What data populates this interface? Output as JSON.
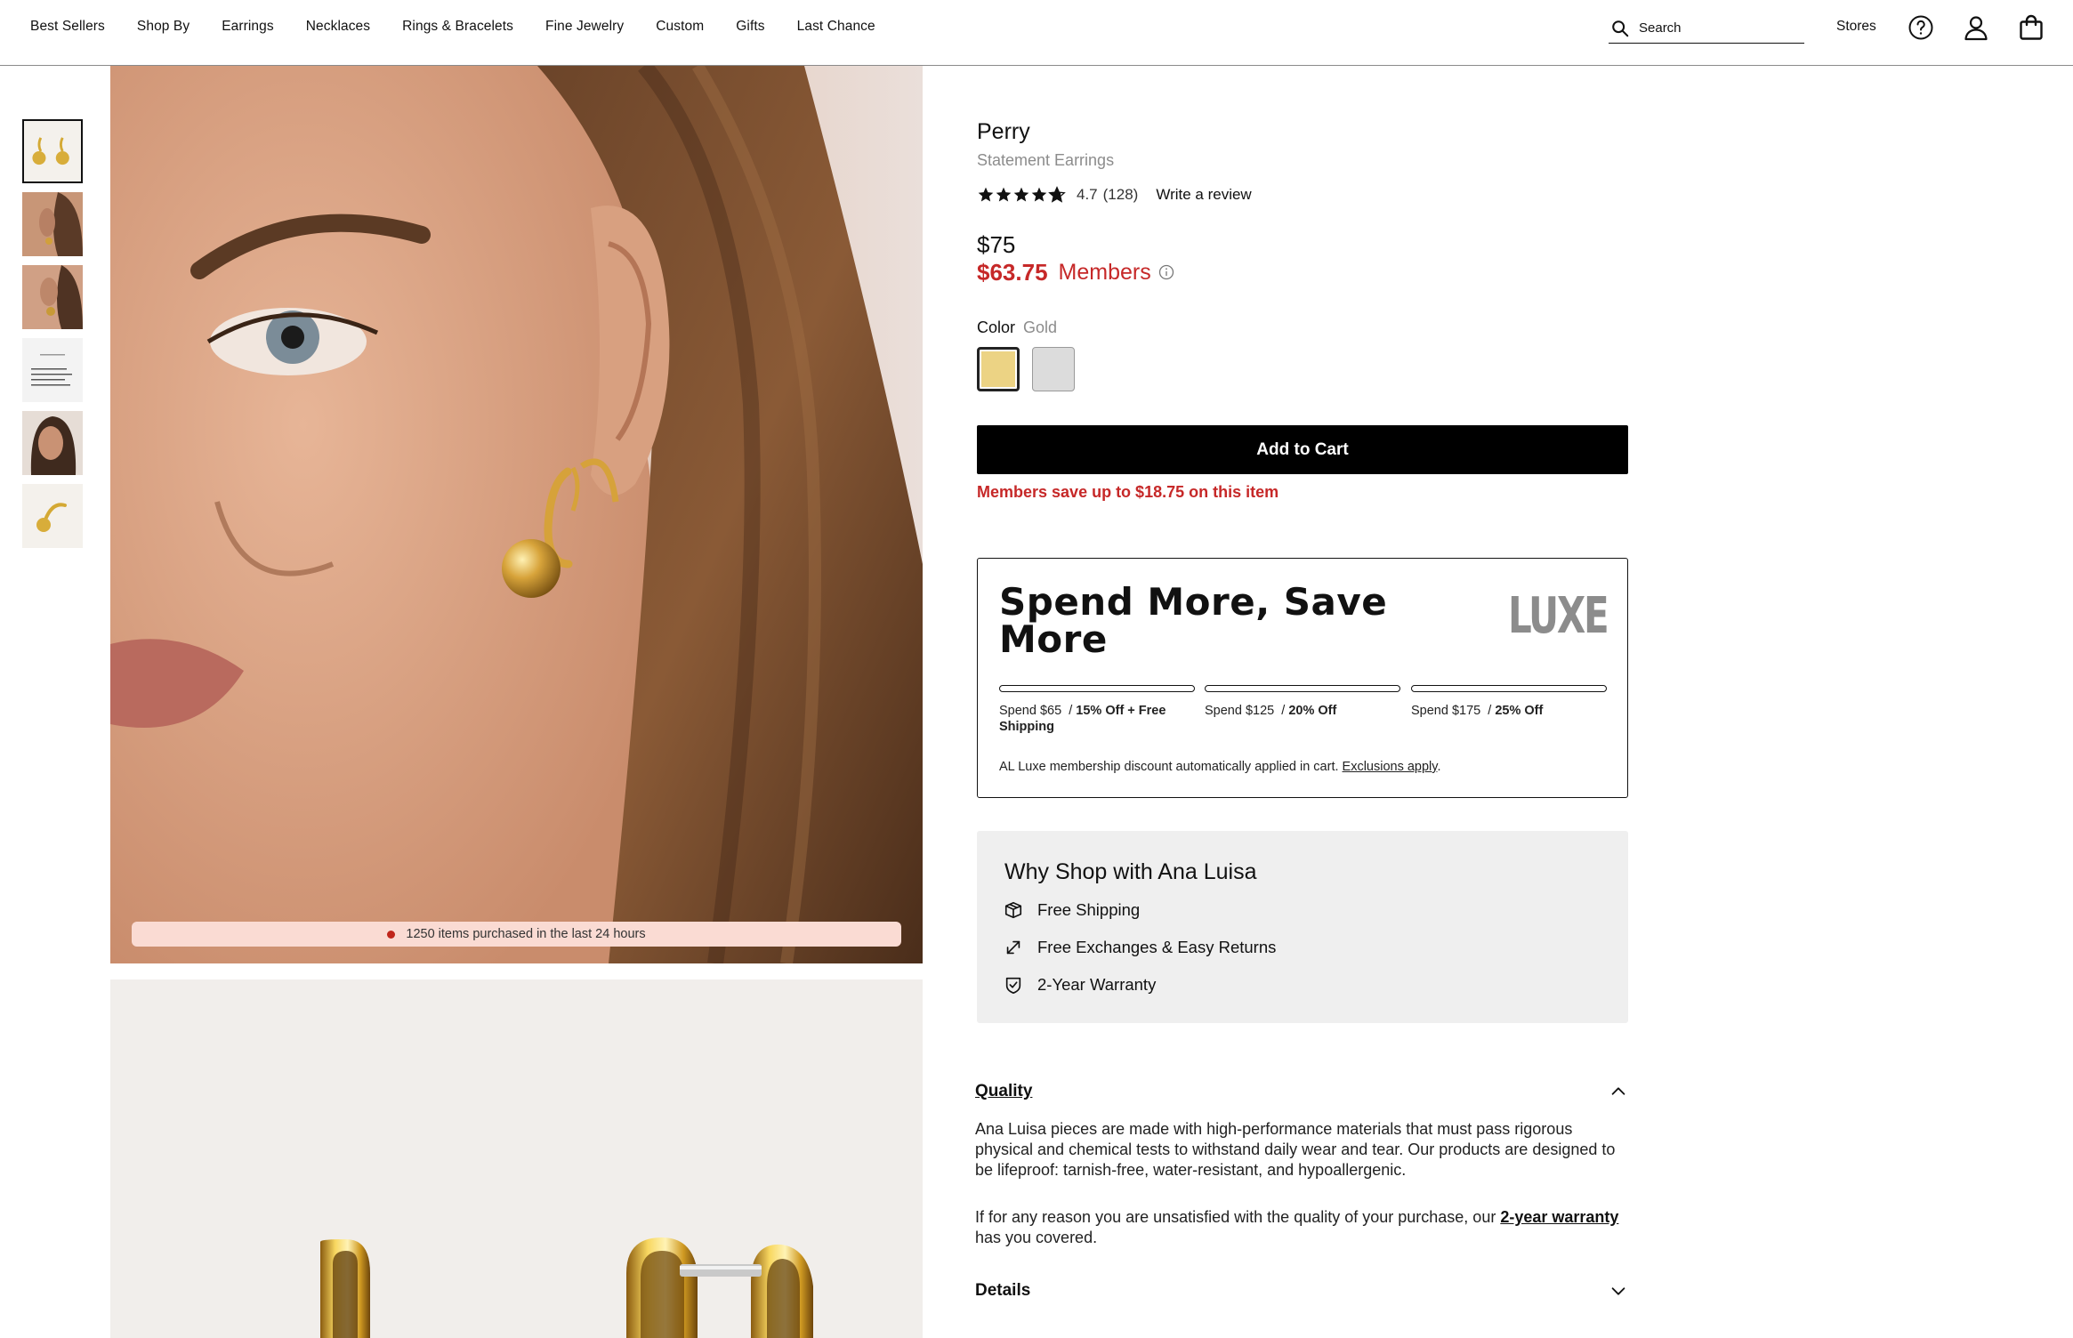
{
  "nav": {
    "items": [
      "Best Sellers",
      "Shop By",
      "Earrings",
      "Necklaces",
      "Rings & Bracelets",
      "Fine Jewelry",
      "Custom",
      "Gifts",
      "Last Chance"
    ],
    "search_placeholder": "Search",
    "stores_label": "Stores",
    "icons": [
      "search-icon",
      "help-icon",
      "account-icon",
      "bag-icon"
    ]
  },
  "gallery": {
    "thumbnails": [
      "thumb-earrings-pair",
      "thumb-model-ear-1",
      "thumb-model-ear-2",
      "thumb-info-card",
      "thumb-model-portrait",
      "thumb-single-earring"
    ],
    "active_index": 0,
    "purchased_text": "1250 items purchased in the last 24 hours"
  },
  "product": {
    "name": "Perry",
    "subtitle": "Statement Earrings",
    "rating": "4.7",
    "review_count": "(128)",
    "stars": 4.7,
    "write_review": "Write a review",
    "price": "$75",
    "member_price": "$63.75",
    "member_label": "Members",
    "color_label": "Color",
    "color_value": "Gold",
    "swatches": [
      {
        "name": "Gold",
        "hex": "#ecd384"
      },
      {
        "name": "Silver",
        "hex": "#dcdcdc"
      }
    ],
    "add_to_cart": "Add to Cart",
    "member_savings": "Members save up to $18.75 on this item"
  },
  "luxe": {
    "title": "Spend More, Save More",
    "logo": "LUXE",
    "tiers": [
      {
        "spend": "Spend $65",
        "reward": "15% Off + Free Shipping"
      },
      {
        "spend": "Spend $125",
        "reward": "20% Off"
      },
      {
        "spend": "Spend $175",
        "reward": "25% Off"
      }
    ],
    "note": "AL Luxe membership discount automatically applied in cart.",
    "exclusions": "Exclusions apply",
    "note_end": "."
  },
  "why": {
    "title": "Why Shop with Ana Luisa",
    "items": [
      {
        "icon": "box-icon",
        "label": "Free Shipping"
      },
      {
        "icon": "exchange-arrows-icon",
        "label": "Free Exchanges & Easy Returns"
      },
      {
        "icon": "shield-check-icon",
        "label": "2-Year Warranty"
      }
    ]
  },
  "accordion": {
    "quality_title": "Quality",
    "quality_p1": "Ana Luisa pieces are made with high-performance materials that must pass rigorous physical and chemical tests to withstand daily wear and tear. Our products are designed to be lifeproof: tarnish-free, water-resistant, and hypoallergenic.",
    "quality_p2_start": "If for any reason you are unsatisfied with the quality of your purchase, our ",
    "quality_p2_link": "2-year warranty",
    "quality_p2_end": " has you covered.",
    "details_title": "Details"
  },
  "colors": {
    "accent_red": "#c62828",
    "cta_black": "#000000",
    "banner_pink": "#fadbd3",
    "why_bg": "#efefef"
  }
}
